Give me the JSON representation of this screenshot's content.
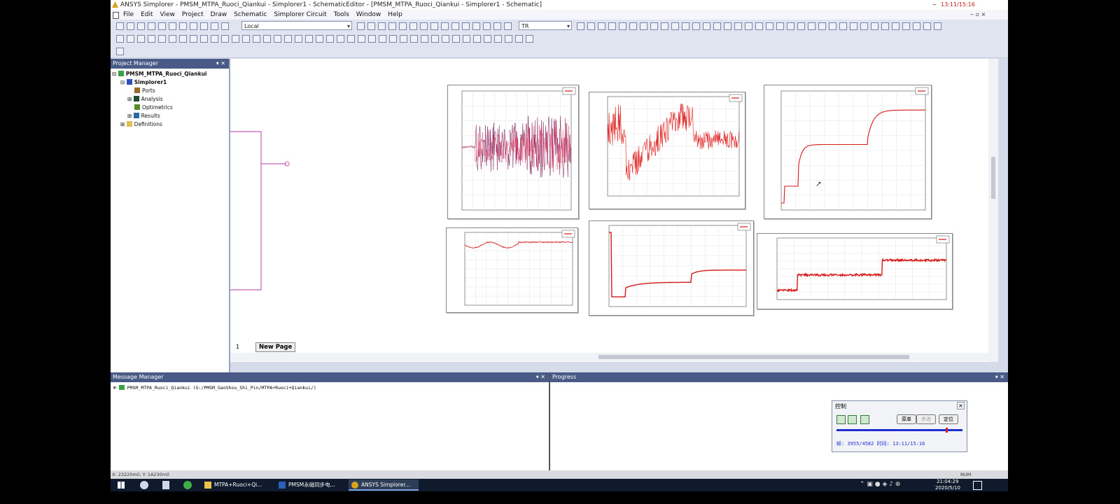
{
  "window_title": "ANSYS Simplorer - PMSM_MTPA_Ruoci_Qiankui - Simplorer1 - SchematicEditor - [PMSM_MTPA_Ruoci_Qiankui - Simplorer1 - Schematic]",
  "top_right_clock": "13:11/15:16",
  "menu": [
    "File",
    "Edit",
    "View",
    "Project",
    "Draw",
    "Schematic",
    "Simplorer Circuit",
    "Tools",
    "Window",
    "Help"
  ],
  "toolbar": {
    "local_dropdown": "Local",
    "tr_dropdown": "TR"
  },
  "project_manager": {
    "title": "Project Manager",
    "root": "PMSM_MTPA_Ruoci_Qiankui",
    "design": "Simplorer1",
    "children": [
      "Ports",
      "Analysis",
      "Optimetrics",
      "Results"
    ],
    "definitions": "Definitions"
  },
  "page_tab": {
    "number": "1",
    "label": "New Page"
  },
  "message_manager": {
    "title": "Message Manager",
    "item": "PMSM_MTPA_Ruoci_Qiankui (G:/PMSM_GaoShou_Shi_Pin/MTPA+Ruoci+Qiankui/)"
  },
  "progress": {
    "title": "Progress"
  },
  "status_bar": {
    "coords": "X: 23220mil, Y: 1A230mil",
    "num": "NUM"
  },
  "control_panel": {
    "title": "控制",
    "menu_btn": "菜单",
    "step_btn": "步进",
    "locate_btn": "定位",
    "frame_info": "帧: 3955/4582 时间: 13:11/15:16"
  },
  "taskbar": {
    "items": [
      "MTPA+Ruoci+Qi...",
      "PMSM永磁同步电...",
      "ANSYS Simplorer..."
    ],
    "time": "21:04:29",
    "date": "2020/5/10"
  },
  "colors": {
    "accent": "#4a5a86",
    "trace": "#d81818",
    "trace_purple": "#7a1450",
    "wire": "#c060b0"
  }
}
